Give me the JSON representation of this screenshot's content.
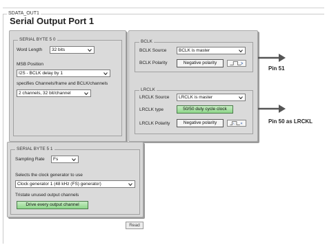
{
  "frame": {
    "legend": "SDATA_OUT1",
    "title": "Serial Output Port 1"
  },
  "serial_byte_50": {
    "legend": "SERIAL BYTE 5 0",
    "word_length_label": "Word Length",
    "word_length_value": "32 bits",
    "msb_position_label": "MSB Position",
    "msb_position_value": "I2S - BCLK delay by 1",
    "channels_help": "specifies Channels/frame and BCLK/channels",
    "channels_value": "2 channels, 32 bit/channel"
  },
  "bclk": {
    "legend": "BCLK",
    "source_label": "BCLK Source",
    "source_value": "BCLK is master",
    "polarity_label": "BCLK Polarity",
    "polarity_value": "Negative polarity"
  },
  "lrclk": {
    "legend": "LRCLK",
    "source_label": "LRCLK Source",
    "source_value": "LRCLK is master",
    "type_label": "LRCLK type",
    "type_value": "50/50 duty cycle clock",
    "polarity_label": "LRCLK Polarity",
    "polarity_value": "Negative polarity"
  },
  "pins": {
    "bclk_pin": "Pin 51",
    "lrclk_pin": "Pin 50 as LRCKL"
  },
  "serial_byte_51": {
    "legend": "SERIAL BYTE 5 1",
    "sampling_rate_label": "Sampling Rate",
    "sampling_rate_value": "Fs",
    "clock_gen_label": "Selects the clock generator to use",
    "clock_gen_value": "Clock generator 1 (48 kHz (FS) generator)",
    "tristate_label": "Tristate unused output channels",
    "tristate_value": "Drive every output channel"
  },
  "read_button": "Read",
  "icons": {
    "dropdown": "chevron-down-icon",
    "arrow": "arrow-right-icon",
    "bclk_wave": "waveform-icon",
    "lrclk_wave": "lr-waveform-icon"
  }
}
